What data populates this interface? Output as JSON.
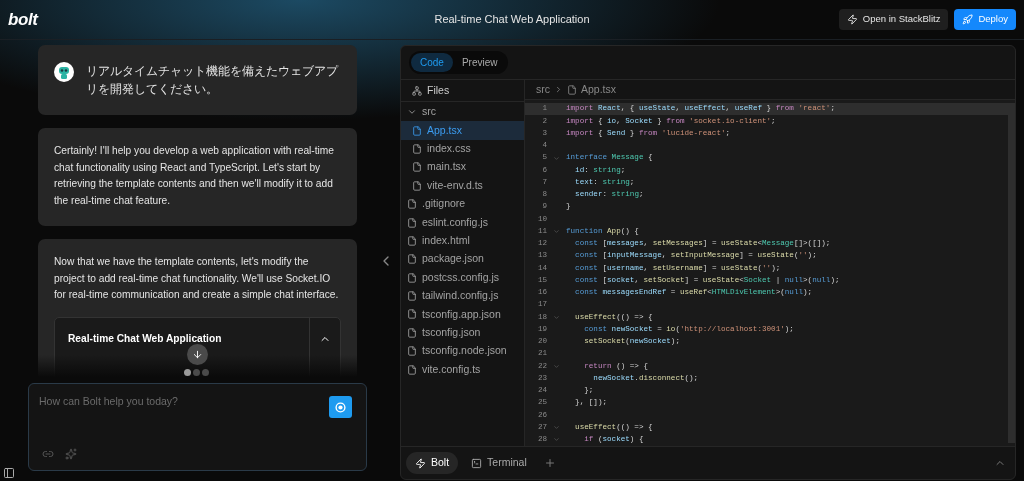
{
  "header": {
    "logo": "bolt",
    "title": "Real-time Chat Web Application",
    "buttons": [
      {
        "label": "Open in StackBlitz",
        "kind": "secondary"
      },
      {
        "label": "Deploy",
        "kind": "primary"
      }
    ]
  },
  "chat": {
    "messages": [
      {
        "kind": "user",
        "text": "リアルタイムチャット機能を備えたウェブアプリを開発してください。"
      },
      {
        "kind": "assistant",
        "text": "Certainly! I'll help you develop a web application with real-time chat functionality using React and TypeScript. Let's start by retrieving the template contents and then we'll modify it to add the real-time chat feature."
      },
      {
        "kind": "assistant",
        "text": "Now that we have the template contents, let's modify the project to add real-time chat functionality. We'll use Socket.IO for real-time communication and create a simple chat interface.",
        "artifact": {
          "title": "Real-time Chat Web Application",
          "expanded": true
        }
      }
    ],
    "dots": [
      {
        "selected": true
      },
      {
        "selected": false
      },
      {
        "selected": false
      }
    ],
    "input": {
      "placeholder": "How can Bolt help you today?"
    }
  },
  "workbench": {
    "tabs": [
      {
        "label": "Code",
        "selected": true
      },
      {
        "label": "Preview",
        "selected": false
      }
    ],
    "files_header": "Files",
    "breadcrumb": [
      "src",
      "App.tsx"
    ],
    "tree": [
      {
        "name": "src",
        "kind": "folder",
        "expanded": true,
        "selected": false,
        "children": [
          {
            "name": "App.tsx",
            "kind": "file",
            "selected": true
          },
          {
            "name": "index.css",
            "kind": "file",
            "selected": false
          },
          {
            "name": "main.tsx",
            "kind": "file",
            "selected": false
          },
          {
            "name": "vite-env.d.ts",
            "kind": "file",
            "selected": false
          }
        ]
      },
      {
        "name": ".gitignore",
        "kind": "file",
        "selected": false
      },
      {
        "name": "eslint.config.js",
        "kind": "file",
        "selected": false
      },
      {
        "name": "index.html",
        "kind": "file",
        "selected": false
      },
      {
        "name": "package.json",
        "kind": "file",
        "selected": false
      },
      {
        "name": "postcss.config.js",
        "kind": "file",
        "selected": false
      },
      {
        "name": "tailwind.config.js",
        "kind": "file",
        "selected": false
      },
      {
        "name": "tsconfig.app.json",
        "kind": "file",
        "selected": false
      },
      {
        "name": "tsconfig.json",
        "kind": "file",
        "selected": false
      },
      {
        "name": "tsconfig.node.json",
        "kind": "file",
        "selected": false
      },
      {
        "name": "vite.config.ts",
        "kind": "file",
        "selected": false
      }
    ],
    "code": [
      {
        "number": "1",
        "foldable": false,
        "highlighted": true,
        "tokens": [
          {
            "kind": "kw",
            "text": "import"
          },
          {
            "kind": "va",
            "text": " React"
          },
          {
            "kind": "p",
            "text": ", { "
          },
          {
            "kind": "va",
            "text": "useState"
          },
          {
            "kind": "p",
            "text": ", "
          },
          {
            "kind": "va",
            "text": "useEffect"
          },
          {
            "kind": "p",
            "text": ", "
          },
          {
            "kind": "va",
            "text": "useRef"
          },
          {
            "kind": "p",
            "text": " } "
          },
          {
            "kind": "kw",
            "text": "from"
          },
          {
            "kind": "str",
            "text": " 'react'"
          },
          {
            "kind": "p",
            "text": ";"
          }
        ]
      },
      {
        "number": "2",
        "foldable": false,
        "highlighted": false,
        "tokens": [
          {
            "kind": "kw",
            "text": "import"
          },
          {
            "kind": "p",
            "text": " { "
          },
          {
            "kind": "va",
            "text": "io"
          },
          {
            "kind": "p",
            "text": ", "
          },
          {
            "kind": "va",
            "text": "Socket"
          },
          {
            "kind": "p",
            "text": " } "
          },
          {
            "kind": "kw",
            "text": "from"
          },
          {
            "kind": "str",
            "text": " 'socket.io-client'"
          },
          {
            "kind": "p",
            "text": ";"
          }
        ]
      },
      {
        "number": "3",
        "foldable": false,
        "highlighted": false,
        "tokens": [
          {
            "kind": "kw",
            "text": "import"
          },
          {
            "kind": "p",
            "text": " { "
          },
          {
            "kind": "va",
            "text": "Send"
          },
          {
            "kind": "p",
            "text": " } "
          },
          {
            "kind": "kw",
            "text": "from"
          },
          {
            "kind": "str",
            "text": " 'lucide-react'"
          },
          {
            "kind": "p",
            "text": ";"
          }
        ]
      },
      {
        "number": "4",
        "foldable": false,
        "highlighted": false
      },
      {
        "number": "5",
        "foldable": true,
        "highlighted": false,
        "tokens": [
          {
            "kind": "dk",
            "text": "interface"
          },
          {
            "kind": "ty",
            "text": " Message"
          },
          {
            "kind": "p",
            "text": " {"
          }
        ]
      },
      {
        "number": "6",
        "foldable": false,
        "highlighted": false,
        "tokens": [
          {
            "kind": "va",
            "text": "  id"
          },
          {
            "kind": "p",
            "text": ": "
          },
          {
            "kind": "ty",
            "text": "string"
          },
          {
            "kind": "p",
            "text": ";"
          }
        ]
      },
      {
        "number": "7",
        "foldable": false,
        "highlighted": false,
        "tokens": [
          {
            "kind": "va",
            "text": "  text"
          },
          {
            "kind": "p",
            "text": ": "
          },
          {
            "kind": "ty",
            "text": "string"
          },
          {
            "kind": "p",
            "text": ";"
          }
        ]
      },
      {
        "number": "8",
        "foldable": false,
        "highlighted": false,
        "tokens": [
          {
            "kind": "va",
            "text": "  sender"
          },
          {
            "kind": "p",
            "text": ": "
          },
          {
            "kind": "ty",
            "text": "string"
          },
          {
            "kind": "p",
            "text": ";"
          }
        ]
      },
      {
        "number": "9",
        "foldable": false,
        "highlighted": false,
        "tokens": [
          {
            "kind": "p",
            "text": "}"
          }
        ]
      },
      {
        "number": "10",
        "foldable": false,
        "highlighted": false
      },
      {
        "number": "11",
        "foldable": true,
        "highlighted": false,
        "tokens": [
          {
            "kind": "dk",
            "text": "function"
          },
          {
            "kind": "fn",
            "text": " App"
          },
          {
            "kind": "p",
            "text": "() {"
          }
        ]
      },
      {
        "number": "12",
        "foldable": false,
        "highlighted": false,
        "tokens": [
          {
            "kind": "dk",
            "text": "  const"
          },
          {
            "kind": "p",
            "text": " ["
          },
          {
            "kind": "va",
            "text": "messages"
          },
          {
            "kind": "p",
            "text": ", "
          },
          {
            "kind": "fn",
            "text": "setMessages"
          },
          {
            "kind": "p",
            "text": "] = "
          },
          {
            "kind": "fn",
            "text": "useState"
          },
          {
            "kind": "p",
            "text": "<"
          },
          {
            "kind": "ty",
            "text": "Message"
          },
          {
            "kind": "p",
            "text": "[]>([]);"
          }
        ]
      },
      {
        "number": "13",
        "foldable": false,
        "highlighted": false,
        "tokens": [
          {
            "kind": "dk",
            "text": "  const"
          },
          {
            "kind": "p",
            "text": " ["
          },
          {
            "kind": "va",
            "text": "inputMessage"
          },
          {
            "kind": "p",
            "text": ", "
          },
          {
            "kind": "fn",
            "text": "setInputMessage"
          },
          {
            "kind": "p",
            "text": "] = "
          },
          {
            "kind": "fn",
            "text": "useState"
          },
          {
            "kind": "p",
            "text": "("
          },
          {
            "kind": "str",
            "text": "''"
          },
          {
            "kind": "p",
            "text": ");"
          }
        ]
      },
      {
        "number": "14",
        "foldable": false,
        "highlighted": false,
        "tokens": [
          {
            "kind": "dk",
            "text": "  const"
          },
          {
            "kind": "p",
            "text": " ["
          },
          {
            "kind": "va",
            "text": "username"
          },
          {
            "kind": "p",
            "text": ", "
          },
          {
            "kind": "fn",
            "text": "setUsername"
          },
          {
            "kind": "p",
            "text": "] = "
          },
          {
            "kind": "fn",
            "text": "useState"
          },
          {
            "kind": "p",
            "text": "("
          },
          {
            "kind": "str",
            "text": "''"
          },
          {
            "kind": "p",
            "text": ");"
          }
        ]
      },
      {
        "number": "15",
        "foldable": false,
        "highlighted": false,
        "tokens": [
          {
            "kind": "dk",
            "text": "  const"
          },
          {
            "kind": "p",
            "text": " ["
          },
          {
            "kind": "va",
            "text": "socket"
          },
          {
            "kind": "p",
            "text": ", "
          },
          {
            "kind": "fn",
            "text": "setSocket"
          },
          {
            "kind": "p",
            "text": "] = "
          },
          {
            "kind": "fn",
            "text": "useState"
          },
          {
            "kind": "p",
            "text": "<"
          },
          {
            "kind": "ty",
            "text": "Socket"
          },
          {
            "kind": "p",
            "text": " | "
          },
          {
            "kind": "dk",
            "text": "null"
          },
          {
            "kind": "p",
            "text": ">("
          },
          {
            "kind": "dk",
            "text": "null"
          },
          {
            "kind": "p",
            "text": ");"
          }
        ]
      },
      {
        "number": "16",
        "foldable": false,
        "highlighted": false,
        "tokens": [
          {
            "kind": "dk",
            "text": "  const"
          },
          {
            "kind": "va",
            "text": " messagesEndRef"
          },
          {
            "kind": "p",
            "text": " = "
          },
          {
            "kind": "fn",
            "text": "useRef"
          },
          {
            "kind": "p",
            "text": "<"
          },
          {
            "kind": "ty",
            "text": "HTMLDivElement"
          },
          {
            "kind": "p",
            "text": ">("
          },
          {
            "kind": "dk",
            "text": "null"
          },
          {
            "kind": "p",
            "text": ");"
          }
        ]
      },
      {
        "number": "17",
        "foldable": false,
        "highlighted": false
      },
      {
        "number": "18",
        "foldable": true,
        "highlighted": false,
        "tokens": [
          {
            "kind": "fn",
            "text": "  useEffect"
          },
          {
            "kind": "p",
            "text": "(() => {"
          }
        ]
      },
      {
        "number": "19",
        "foldable": false,
        "highlighted": false,
        "tokens": [
          {
            "kind": "dk",
            "text": "    const"
          },
          {
            "kind": "va",
            "text": " newSocket"
          },
          {
            "kind": "p",
            "text": " = "
          },
          {
            "kind": "fn",
            "text": "io"
          },
          {
            "kind": "p",
            "text": "("
          },
          {
            "kind": "str",
            "text": "'http://localhost:3001'"
          },
          {
            "kind": "p",
            "text": ");"
          }
        ]
      },
      {
        "number": "20",
        "foldable": false,
        "highlighted": false,
        "tokens": [
          {
            "kind": "fn",
            "text": "    setSocket"
          },
          {
            "kind": "p",
            "text": "("
          },
          {
            "kind": "va",
            "text": "newSocket"
          },
          {
            "kind": "p",
            "text": ");"
          }
        ]
      },
      {
        "number": "21",
        "foldable": false,
        "highlighted": false
      },
      {
        "number": "22",
        "foldable": true,
        "highlighted": false,
        "tokens": [
          {
            "kind": "kw",
            "text": "    return"
          },
          {
            "kind": "p",
            "text": " () => {"
          }
        ]
      },
      {
        "number": "23",
        "foldable": false,
        "highlighted": false,
        "tokens": [
          {
            "kind": "va",
            "text": "      newSocket"
          },
          {
            "kind": "p",
            "text": "."
          },
          {
            "kind": "fn",
            "text": "disconnect"
          },
          {
            "kind": "p",
            "text": "();"
          }
        ]
      },
      {
        "number": "24",
        "foldable": false,
        "highlighted": false,
        "tokens": [
          {
            "kind": "p",
            "text": "    };"
          }
        ]
      },
      {
        "number": "25",
        "foldable": false,
        "highlighted": false,
        "tokens": [
          {
            "kind": "p",
            "text": "  }, []);"
          }
        ]
      },
      {
        "number": "26",
        "foldable": false,
        "highlighted": false
      },
      {
        "number": "27",
        "foldable": true,
        "highlighted": false,
        "tokens": [
          {
            "kind": "fn",
            "text": "  useEffect"
          },
          {
            "kind": "p",
            "text": "(() => {"
          }
        ]
      },
      {
        "number": "28",
        "foldable": true,
        "highlighted": false,
        "tokens": [
          {
            "kind": "kw",
            "text": "    if"
          },
          {
            "kind": "p",
            "text": " ("
          },
          {
            "kind": "va",
            "text": "socket"
          },
          {
            "kind": "p",
            "text": ") {"
          }
        ]
      }
    ],
    "bottom_tabs": [
      {
        "label": "Bolt",
        "kind": "bolt",
        "selected": true
      },
      {
        "label": "Terminal",
        "kind": "terminal",
        "selected": false
      }
    ]
  }
}
